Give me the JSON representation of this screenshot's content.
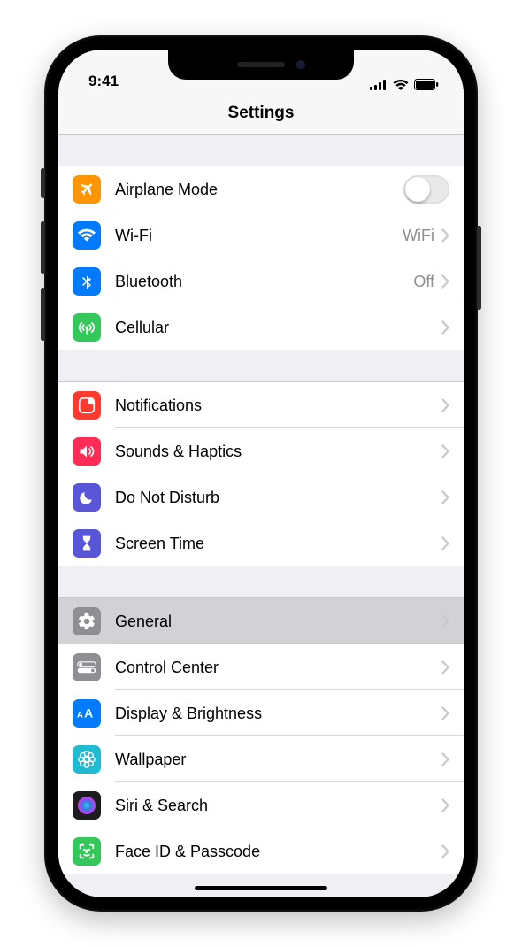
{
  "status": {
    "time": "9:41"
  },
  "nav": {
    "title": "Settings"
  },
  "groups": [
    {
      "rows": [
        {
          "key": "airplane",
          "label": "Airplane Mode",
          "icon": "airplane",
          "iconBg": "#ff9500",
          "control": "switch",
          "switchOn": false
        },
        {
          "key": "wifi",
          "label": "Wi-Fi",
          "icon": "wifi",
          "iconBg": "#007aff",
          "control": "chevron",
          "value": "WiFi"
        },
        {
          "key": "bluetooth",
          "label": "Bluetooth",
          "icon": "bluetooth",
          "iconBg": "#007aff",
          "control": "chevron",
          "value": "Off"
        },
        {
          "key": "cellular",
          "label": "Cellular",
          "icon": "cellular",
          "iconBg": "#34c759",
          "control": "chevron"
        }
      ]
    },
    {
      "rows": [
        {
          "key": "notifications",
          "label": "Notifications",
          "icon": "notifications",
          "iconBg": "#ff3b30",
          "control": "chevron"
        },
        {
          "key": "sounds",
          "label": "Sounds & Haptics",
          "icon": "sounds",
          "iconBg": "#ff2d55",
          "control": "chevron"
        },
        {
          "key": "dnd",
          "label": "Do Not Disturb",
          "icon": "moon",
          "iconBg": "#5856d6",
          "control": "chevron"
        },
        {
          "key": "screentime",
          "label": "Screen Time",
          "icon": "hourglass",
          "iconBg": "#5856d6",
          "control": "chevron"
        }
      ]
    },
    {
      "rows": [
        {
          "key": "general",
          "label": "General",
          "icon": "gear",
          "iconBg": "#8e8e93",
          "control": "chevron",
          "pressed": true
        },
        {
          "key": "control",
          "label": "Control Center",
          "icon": "switches",
          "iconBg": "#8e8e93",
          "control": "chevron"
        },
        {
          "key": "display",
          "label": "Display & Brightness",
          "icon": "aa",
          "iconBg": "#007aff",
          "control": "chevron"
        },
        {
          "key": "wallpaper",
          "label": "Wallpaper",
          "icon": "flower",
          "iconBg": "#20bad3",
          "control": "chevron"
        },
        {
          "key": "siri",
          "label": "Siri & Search",
          "icon": "siri",
          "iconBg": "#1c1c1e",
          "control": "chevron"
        },
        {
          "key": "faceid",
          "label": "Face ID & Passcode",
          "icon": "face",
          "iconBg": "#34c759",
          "control": "chevron"
        }
      ]
    }
  ]
}
